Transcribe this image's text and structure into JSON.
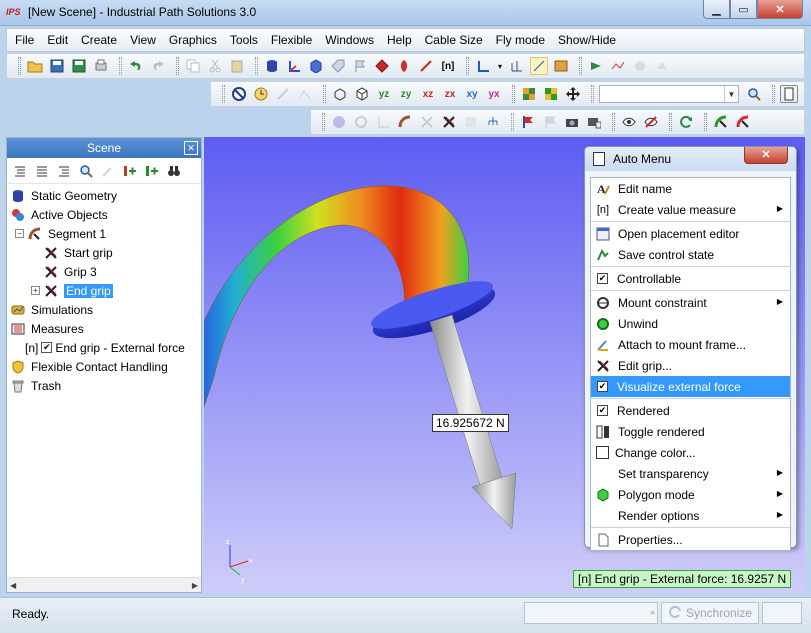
{
  "window": {
    "title": "[New Scene] - Industrial Path Solutions 3.0",
    "logo_text": "IPS",
    "min_glyph": "▁",
    "max_glyph": "▭",
    "close_glyph": "✕"
  },
  "menu": {
    "items": [
      "File",
      "Edit",
      "Create",
      "View",
      "Graphics",
      "Tools",
      "Flexible",
      "Windows",
      "Help",
      "Cable Size",
      "Fly mode",
      "Show/Hide"
    ]
  },
  "toolbar": {
    "value_measure_label": "[n]"
  },
  "scene": {
    "title": "Scene",
    "close_glyph": "✕",
    "tree": {
      "static_geometry": "Static Geometry",
      "active_objects": "Active Objects",
      "segment": "Segment 1",
      "start_grip": "Start grip",
      "grip3": "Grip 3",
      "end_grip": "End grip",
      "simulations": "Simulations",
      "measures": "Measures",
      "measure_prefix": "[n]",
      "measure_item": "End grip - External force",
      "flexible_contact": "Flexible Contact Handling",
      "trash": "Trash"
    },
    "collapse_glyph": "−",
    "expand_glyph": "+",
    "check_glyph": "✔",
    "scroll_left": "◀",
    "scroll_right": "▶"
  },
  "viewport": {
    "force_label": "16.925672 N",
    "status_overlay": "[n] End grip - External force: 16.9257 N",
    "axis_x": "x",
    "axis_y": "y",
    "axis_z": "z"
  },
  "auto_menu": {
    "title": "Auto Menu",
    "close_glyph": "✕",
    "items": {
      "edit_name": "Edit name",
      "create_value_measure_prefix": "[n]",
      "create_value_measure": "Create value measure",
      "open_placement_editor": "Open placement editor",
      "save_control_state": "Save control state",
      "controllable": "Controllable",
      "mount_constraint": "Mount constraint",
      "unwind": "Unwind",
      "attach_to_mount_frame": "Attach to mount frame...",
      "edit_grip": "Edit grip...",
      "visualize_external_force": "Visualize external force",
      "rendered": "Rendered",
      "toggle_rendered": "Toggle rendered",
      "change_color": "Change color...",
      "set_transparency": "Set transparency",
      "polygon_mode": "Polygon mode",
      "render_options": "Render options",
      "properties": "Properties..."
    },
    "check_glyph": "✔",
    "arrow_glyph": "▶"
  },
  "statusbar": {
    "ready": "Ready.",
    "synchronize": "Synchronize",
    "chevron": "»"
  }
}
